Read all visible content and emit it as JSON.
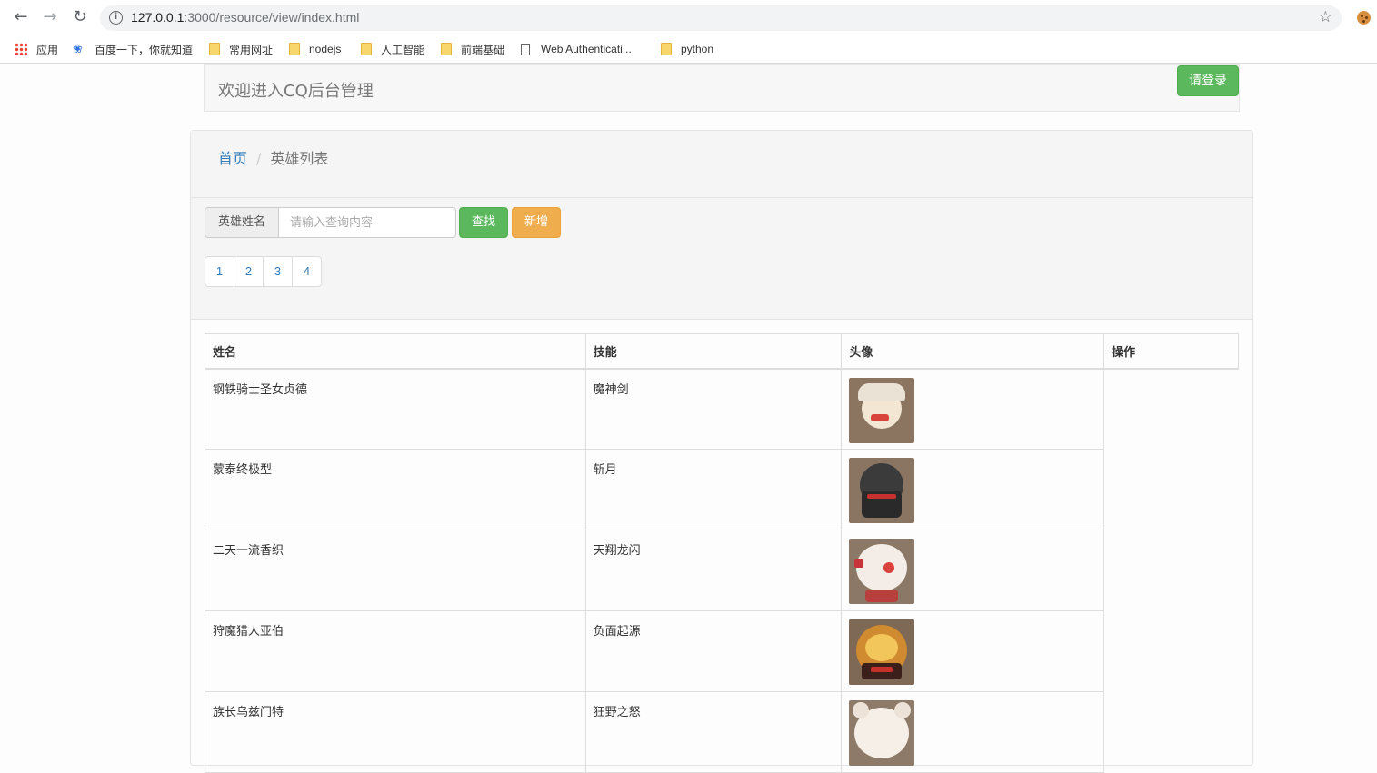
{
  "browser": {
    "url_host": "127.0.0.1",
    "url_rest": ":3000/resource/view/index.html",
    "bookmarks": [
      "应用",
      "百度一下，你就知道",
      "常用网址",
      "nodejs",
      "人工智能",
      "前端基础",
      "Web Authenticati...",
      "python"
    ]
  },
  "header": {
    "title": "欢迎进入CQ后台管理",
    "login_label": "请登录"
  },
  "breadcrumb": {
    "home": "首页",
    "separator": "/",
    "current": "英雄列表"
  },
  "search": {
    "addon_label": "英雄姓名",
    "placeholder": "请输入查询内容",
    "find_label": "查找",
    "add_label": "新增"
  },
  "pagination": [
    "1",
    "2",
    "3",
    "4"
  ],
  "table": {
    "headers": [
      "姓名",
      "技能",
      "头像",
      "操作"
    ],
    "rows": [
      {
        "name": "钢铁骑士圣女贞德",
        "skill": "魔神剑"
      },
      {
        "name": "蒙泰终极型",
        "skill": "斩月"
      },
      {
        "name": "二天一流香织",
        "skill": "天翔龙闪"
      },
      {
        "name": "狩魔猎人亚伯",
        "skill": "负面起源"
      },
      {
        "name": "族长乌兹门特",
        "skill": "狂野之怒"
      }
    ]
  },
  "colors": {
    "success": "#5cb85c",
    "warning": "#f0ad4e",
    "link": "#337ab7"
  }
}
